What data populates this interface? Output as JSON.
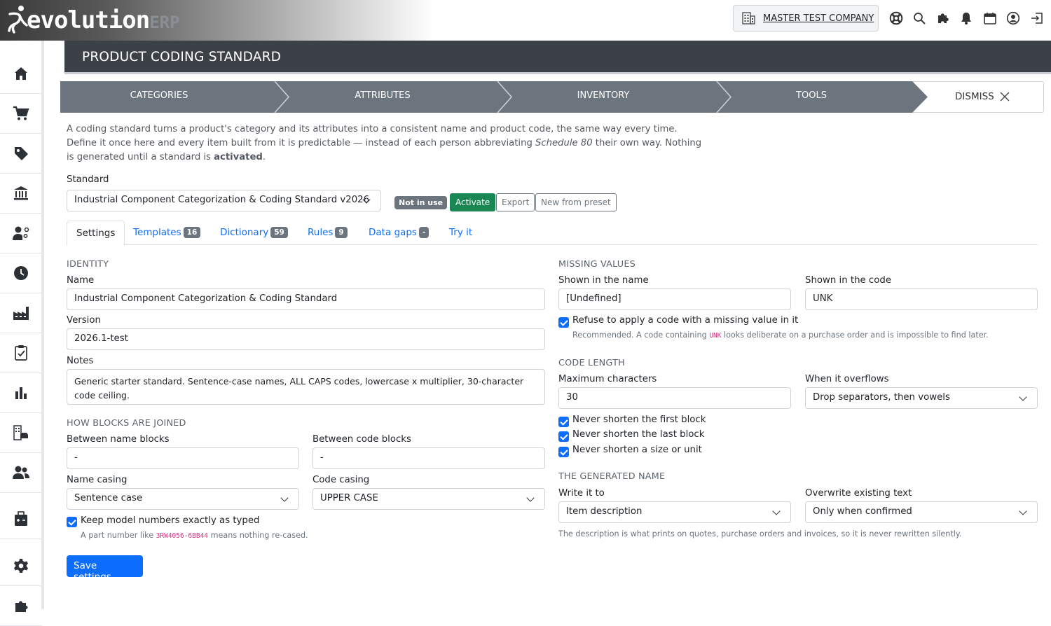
{
  "app": {
    "logo_main": "evolution",
    "logo_suffix": "ERP",
    "company": "MASTER TEST COMPANY"
  },
  "page": {
    "title": "PRODUCT CODING STANDARD"
  },
  "steps": [
    {
      "label": "CATEGORIES"
    },
    {
      "label": "ATTRIBUTES"
    },
    {
      "label": "INVENTORY"
    },
    {
      "label": "TOOLS"
    }
  ],
  "dismiss_label": "DISMISS",
  "intro": {
    "line1": "A coding standard turns a product's category and its attributes into a consistent name and product code, the same way every time.",
    "line2_a": "Define it once here and every item built from it is predictable — instead of each person abbreviating ",
    "line2_em": "Schedule 80",
    "line2_b": " their own way. Nothing",
    "line3_a": "is generated until a standard is ",
    "line3_b": "activated",
    "line3_c": "."
  },
  "standard": {
    "label": "Standard",
    "selected": "Industrial Component Categorization & Coding Standard v2026",
    "status_badge": "Not in use",
    "activate": "Activate",
    "export": "Export",
    "new_from_preset": "New from preset"
  },
  "tabs": [
    {
      "label": "Settings",
      "count": ""
    },
    {
      "label": "Templates",
      "count": "16"
    },
    {
      "label": "Dictionary",
      "count": "59"
    },
    {
      "label": "Rules",
      "count": "9"
    },
    {
      "label": "Data gaps",
      "count": "-"
    },
    {
      "label": "Try it",
      "count": ""
    }
  ],
  "identity": {
    "heading": "IDENTITY",
    "name_label": "Name",
    "name_value": "Industrial Component Categorization & Coding Standard",
    "version_label": "Version",
    "version_value": "2026.1-test",
    "notes_label": "Notes",
    "notes_value": "Generic starter standard. Sentence-case names, ALL CAPS codes, lowercase x multiplier, 30-character code ceiling."
  },
  "joining": {
    "heading": "HOW BLOCKS ARE JOINED",
    "between_name_label": "Between name blocks",
    "between_name_value": "-",
    "between_code_label": "Between code blocks",
    "between_code_value": "-",
    "name_casing_label": "Name casing",
    "name_casing_value": "Sentence case",
    "code_casing_label": "Code casing",
    "code_casing_value": "UPPER CASE",
    "keep_model_label": "Keep model numbers exactly as typed",
    "keep_model_help_a": "A part number like ",
    "keep_model_help_code": "3RW4056-6BB44",
    "keep_model_help_b": " means nothing re-cased."
  },
  "missing": {
    "heading": "MISSING VALUES",
    "in_name_label": "Shown in the name",
    "in_name_value": "[Undefined]",
    "in_code_label": "Shown in the code",
    "in_code_value": "UNK",
    "refuse_label": "Refuse to apply a code with a missing value in it",
    "refuse_help_a": "Recommended. A code containing ",
    "refuse_help_code": "UNK",
    "refuse_help_b": " looks deliberate on a purchase order and is impossible to find later."
  },
  "length": {
    "heading": "CODE LENGTH",
    "max_label": "Maximum characters",
    "max_value": "30",
    "overflow_label": "When it overflows",
    "overflow_value": "Drop separators, then vowels",
    "never_first": "Never shorten the first block",
    "never_last": "Never shorten the last block",
    "never_size": "Never shorten a size or unit"
  },
  "generated": {
    "heading": "THE GENERATED NAME",
    "write_label": "Write it to",
    "write_value": "Item description",
    "overwrite_label": "Overwrite existing text",
    "overwrite_value": "Only when confirmed",
    "help": "The description is what prints on quotes, purchase orders and invoices, so it is never rewritten silently."
  },
  "save_label": "Save settings",
  "colors": {
    "accent": "#0d6efd",
    "success": "#198754",
    "header": "#3c4148",
    "steps": "#6c757d"
  }
}
